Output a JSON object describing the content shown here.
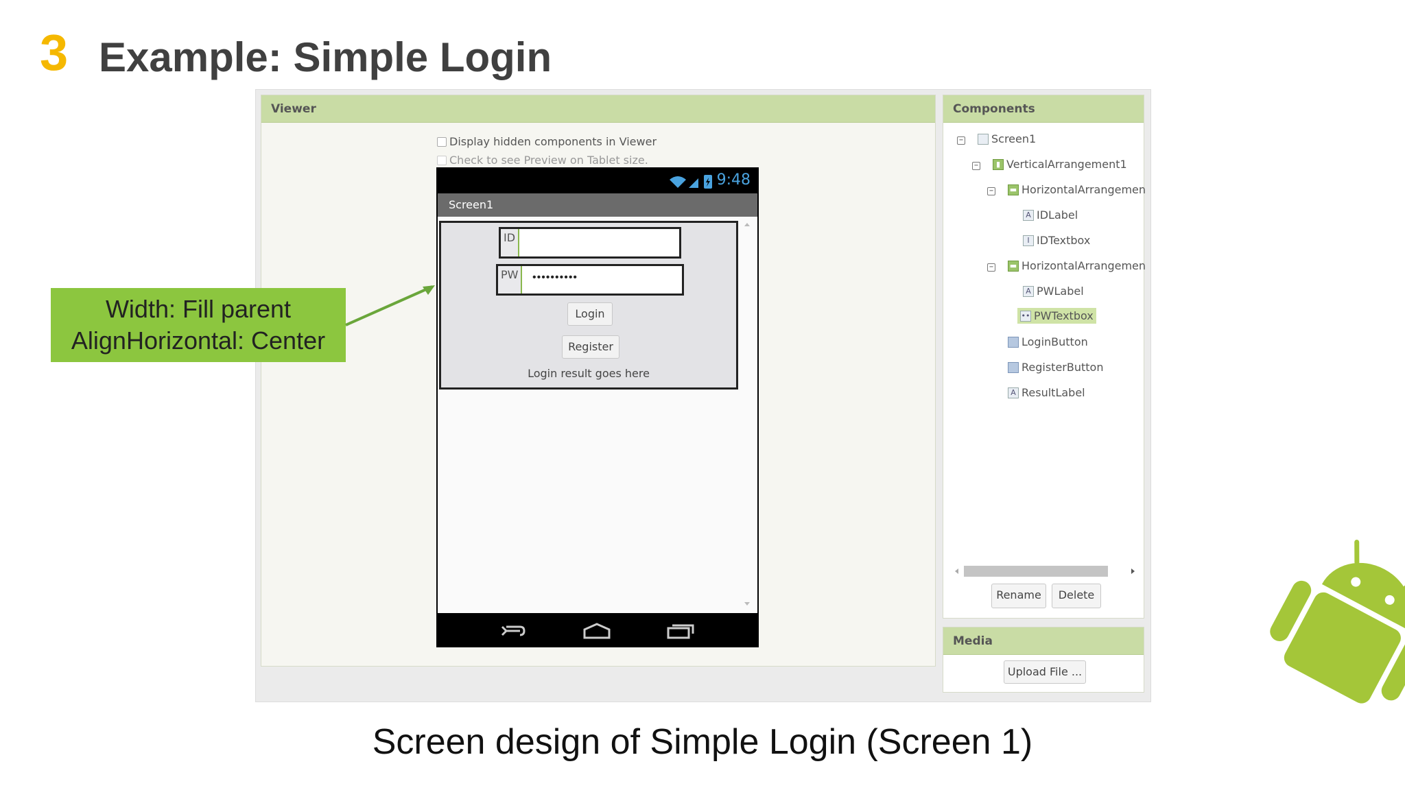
{
  "slide": {
    "number": "3",
    "title": "Example: Simple Login",
    "caption": "Screen design of Simple Login (Screen 1)"
  },
  "annotation": {
    "line1": "Width: Fill parent",
    "line2": "AlignHorizontal: Center"
  },
  "viewer": {
    "header": "Viewer",
    "checkbox_hidden": "Display hidden components in Viewer",
    "checkbox_tablet": "Check to see Preview on Tablet size.",
    "phone": {
      "time": "9:48",
      "screen_title": "Screen1",
      "id_label": "ID",
      "id_value": "",
      "pw_label": "PW",
      "pw_value": "••••••••••",
      "login_button": "Login",
      "register_button": "Register",
      "result_text": "Login result goes here"
    }
  },
  "components": {
    "header": "Components",
    "tree": [
      {
        "label": "Screen1",
        "icon": "screen-icon"
      },
      {
        "label": "VerticalArrangement1",
        "icon": "vertical-arrangement-icon"
      },
      {
        "label": "HorizontalArrangemen",
        "icon": "horizontal-arrangement-icon"
      },
      {
        "label": "IDLabel",
        "icon": "label-icon"
      },
      {
        "label": "IDTextbox",
        "icon": "textbox-icon"
      },
      {
        "label": "HorizontalArrangemen",
        "icon": "horizontal-arrangement-icon"
      },
      {
        "label": "PWLabel",
        "icon": "label-icon"
      },
      {
        "label": "PWTextbox",
        "icon": "password-textbox-icon"
      },
      {
        "label": "LoginButton",
        "icon": "button-icon"
      },
      {
        "label": "RegisterButton",
        "icon": "button-icon"
      },
      {
        "label": "ResultLabel",
        "icon": "label-icon"
      }
    ],
    "selected": "PWTextbox",
    "rename_button": "Rename",
    "delete_button": "Delete"
  },
  "media": {
    "header": "Media",
    "upload_button": "Upload File ..."
  },
  "colors": {
    "accent_number": "#f5b800",
    "panel_header": "#c9dca5",
    "annotation_bg": "#8cc63f",
    "android_green": "#a4c639"
  }
}
